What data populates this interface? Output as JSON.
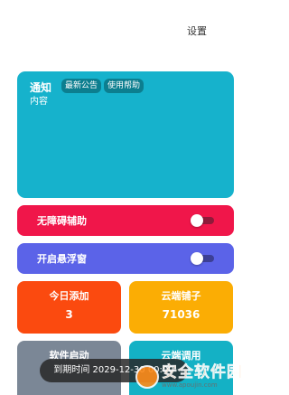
{
  "header": {
    "settings_label": "设置"
  },
  "notice": {
    "title": "通知",
    "content": "内容",
    "chip_news": "最新公告",
    "chip_help": "使用帮助"
  },
  "toggles": {
    "accessibility": {
      "label": "无障碍辅助",
      "enabled": false
    },
    "floating_window": {
      "label": "开启悬浮窗",
      "enabled": false
    }
  },
  "stats": {
    "today_added": {
      "title": "今日添加",
      "value": "3"
    },
    "cloud_shop": {
      "title": "云端铺子",
      "value": "71036"
    },
    "software_start": {
      "title": "软件启动"
    },
    "cloud_call": {
      "title": "云端调用"
    }
  },
  "toast": {
    "text": "到期时间 2029-12-30 00:00"
  },
  "watermark": {
    "main": "安全软件园",
    "url": "www.apoujin.com"
  },
  "colors": {
    "notice_bg": "#16b2cc",
    "accessibility_bg": "#f0164a",
    "float_bg": "#5b63e8",
    "today_bg": "#fb4a0f",
    "cloud_shop_bg": "#fbad04",
    "software_bg": "#7b8796",
    "cloud_call_bg": "#14b1c5"
  }
}
